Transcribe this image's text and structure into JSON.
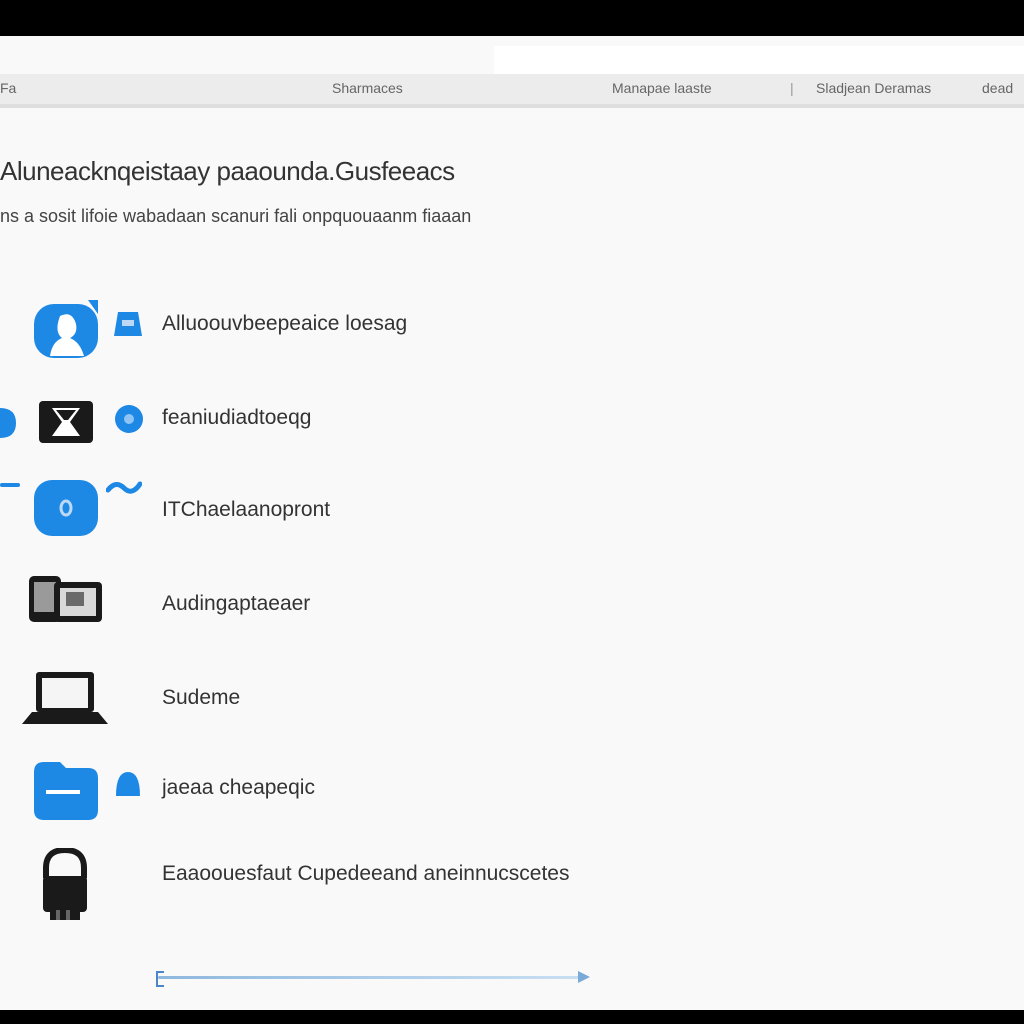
{
  "header": {
    "left_label": "Fa",
    "center_label": "Sharmaces",
    "right_label_1": "Manapae laaste",
    "right_sep": "|",
    "right_label_2": "Sladjean Deramas",
    "right_label_3": "dead"
  },
  "main": {
    "title": "Aluneacknqeistaay paaounda.Gusfeeacs",
    "subtitle": "ns a sosit lifoie wabadaan scanuri fali onpquouaanm fiaaan"
  },
  "items": [
    {
      "label": "Alluoouvbeepeaice loesag",
      "icon": "badge-person-icon"
    },
    {
      "label": "feaniudiadtoeqg",
      "icon": "hourglass-icon"
    },
    {
      "label": "ITChaelaanopront",
      "icon": "chat-bubble-icon"
    },
    {
      "label": "Audingaptaeaer",
      "icon": "device-reader-icon"
    },
    {
      "label": "Sudeme",
      "icon": "laptop-icon"
    },
    {
      "label": "jaeaa cheapeqic",
      "icon": "folder-icon"
    },
    {
      "label": "Eaaoouesfaut Cupedeeand aneinnucscetes",
      "icon": "lock-icon"
    }
  ],
  "colors": {
    "accent": "#1e88e5",
    "dark": "#1a1a1a",
    "background": "#f9f9f9"
  }
}
